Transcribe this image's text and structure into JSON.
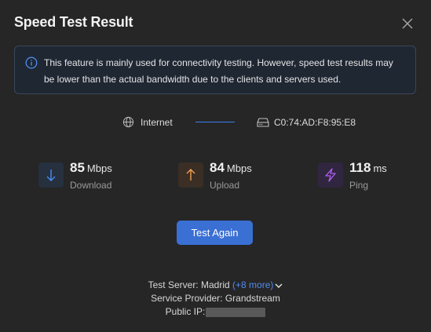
{
  "dialog": {
    "title": "Speed Test Result"
  },
  "info": {
    "text": "This feature is mainly used for connectivity testing. However, speed test results may be lower than the actual bandwidth due to the clients and servers used."
  },
  "path": {
    "source": "Internet",
    "device": "C0:74:AD:F8:95:E8"
  },
  "metrics": {
    "download": {
      "value": "85",
      "unit": "Mbps",
      "label": "Download"
    },
    "upload": {
      "value": "84",
      "unit": "Mbps",
      "label": "Upload"
    },
    "ping": {
      "value": "118",
      "unit": "ms",
      "label": "Ping"
    }
  },
  "actions": {
    "test_again": "Test Again"
  },
  "footer": {
    "server_label": "Test Server: Madrid",
    "server_more": "(+8 more)",
    "provider": "Service Provider: Grandstream",
    "public_ip_label": "Public IP:"
  },
  "colors": {
    "accent": "#3a6fd4",
    "link": "#4f8cf0",
    "download": "#4a8cf5",
    "upload": "#f0a050",
    "ping": "#b060f0"
  }
}
